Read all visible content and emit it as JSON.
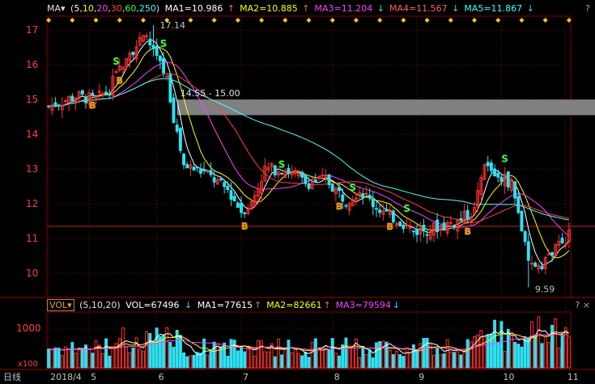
{
  "price_header": {
    "indicator": "MA▾",
    "periods_open": "(",
    "periods": [
      {
        "text": "5",
        "color": "#ffffff"
      },
      {
        "text": "10",
        "color": "#ffff00"
      },
      {
        "text": "20",
        "color": "#ff40ff"
      },
      {
        "text": "30",
        "color": "#ff4040"
      },
      {
        "text": "60",
        "color": "#40ff40"
      },
      {
        "text": "250",
        "color": "#40ffff"
      }
    ],
    "periods_close": ")",
    "mas": [
      {
        "label": "MA1=10.986",
        "arrow": "↑",
        "arrow_dir": "up",
        "color": "#ffffff"
      },
      {
        "label": "MA2=10.885",
        "arrow": "↑",
        "arrow_dir": "up",
        "color": "#ffff00"
      },
      {
        "label": "MA3=11.204",
        "arrow": "↓",
        "arrow_dir": "down",
        "color": "#ff40ff"
      },
      {
        "label": "MA4=11.567",
        "arrow": "↓",
        "arrow_dir": "down",
        "color": "#ff6060"
      },
      {
        "label": "MA5=11.867",
        "arrow": "↓",
        "arrow_dir": "down",
        "color": "#40ffff"
      }
    ],
    "help": "?"
  },
  "volume_header": {
    "indicator": "VOL▾",
    "periods": "(5,10,20)",
    "vol": "VOL=67496",
    "vol_arrow": "↓",
    "mas": [
      {
        "label": "MA1=77615",
        "arrow": "↑",
        "arrow_dir": "up",
        "color": "#ffffff"
      },
      {
        "label": "MA2=82661",
        "arrow": "↑",
        "arrow_dir": "up",
        "color": "#ffff00"
      },
      {
        "label": "MA3=79594",
        "arrow": "↓",
        "arrow_dir": "down",
        "color": "#ff40ff"
      }
    ],
    "controls": "? ×"
  },
  "chart_data": {
    "type": "candlestick",
    "period_label": "日线",
    "x_labels": [
      "2018/4",
      "5",
      "6",
      "7",
      "8",
      "9",
      "10",
      "11"
    ],
    "y_ticks": [
      10,
      11,
      12,
      13,
      14,
      15,
      16,
      17
    ],
    "ylim": [
      9.3,
      17.4
    ],
    "volume_ticks": [
      "1000"
    ],
    "volume_unit": "x100",
    "annotations": {
      "high": "17.14",
      "low": "9.59",
      "gap_zone": "14.55 - 15.00",
      "gap_range": [
        14.55,
        15.0
      ],
      "current_price_line": 11.35
    },
    "signals": {
      "buy_label": "B",
      "sell_label": "S",
      "buy_index": [
        13,
        21,
        58,
        86,
        101,
        124
      ],
      "sell_index": [
        20,
        34,
        69,
        90,
        106,
        135
      ]
    },
    "colors": {
      "up": "#ff3030",
      "down": "#30e0f0",
      "ma5": "#ffffff",
      "ma10": "#ffff00",
      "ma20": "#ff40ff",
      "ma30": "#ff4040",
      "ma60": "#40ffff",
      "grid": "#800000",
      "gap": "#808080"
    },
    "trend": [
      [
        0,
        14.8
      ],
      [
        8,
        15.1
      ],
      [
        14,
        15.0
      ],
      [
        18,
        15.3
      ],
      [
        23,
        16.3
      ],
      [
        29,
        16.8
      ],
      [
        35,
        15.6
      ],
      [
        37,
        14.5
      ],
      [
        40,
        13.1
      ],
      [
        46,
        12.9
      ],
      [
        53,
        12.4
      ],
      [
        57,
        11.8
      ],
      [
        60,
        12.0
      ],
      [
        64,
        13.0
      ],
      [
        70,
        13.0
      ],
      [
        76,
        12.6
      ],
      [
        82,
        12.7
      ],
      [
        88,
        12.1
      ],
      [
        92,
        12.4
      ],
      [
        96,
        12.0
      ],
      [
        100,
        11.7
      ],
      [
        104,
        11.5
      ],
      [
        108,
        11.2
      ],
      [
        114,
        11.3
      ],
      [
        121,
        11.5
      ],
      [
        126,
        11.8
      ],
      [
        129,
        13.1
      ],
      [
        133,
        12.8
      ],
      [
        137,
        12.6
      ],
      [
        140,
        11.3
      ],
      [
        142,
        10.2
      ],
      [
        146,
        10.3
      ],
      [
        150,
        10.7
      ],
      [
        154,
        11.1
      ]
    ],
    "candle_count": 155,
    "index_of_labels": [
      0,
      12,
      32,
      57,
      84,
      109,
      134,
      153
    ]
  }
}
